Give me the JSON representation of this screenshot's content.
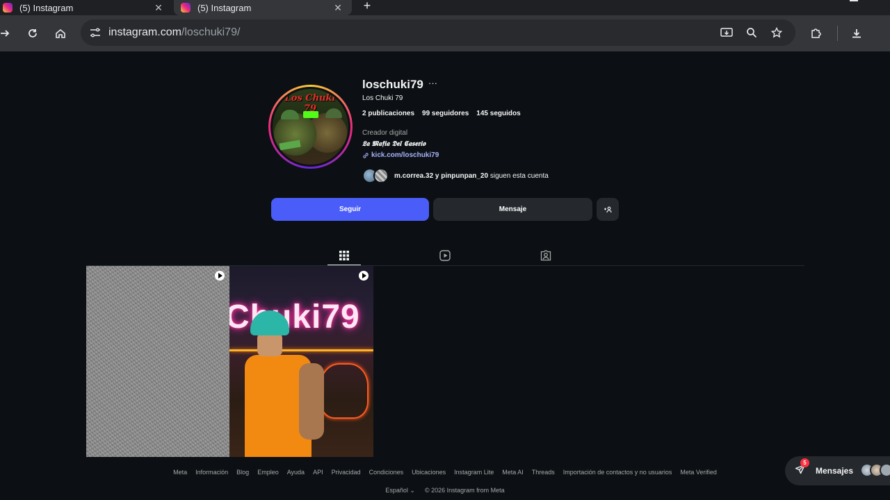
{
  "browser": {
    "tabs": [
      {
        "title": "(5) Instagram"
      },
      {
        "title": "(5) Instagram"
      }
    ],
    "url_host": "instagram.com",
    "url_path": "/loschuki79/"
  },
  "profile": {
    "username": "loschuki79",
    "full_name": "Los Chuki 79",
    "posts": "2 publicaciones",
    "followers": "99 seguidores",
    "following": "145 seguidos",
    "category": "Creador digital",
    "bio": "𝕷𝖆 𝕸𝖆𝖋𝖎𝖆 𝕯𝖊𝖑 𝕮𝖆𝖘𝖊𝖗𝖎𝖔",
    "link": "kick.com/loschuki79",
    "followed_by_names": "m.correa.32 y pinpunpan_20",
    "followed_by_suffix": " siguen esta cuenta",
    "avatar_text": "Los Chuki 79",
    "avatar_logo": "Los Chuki 79"
  },
  "actions": {
    "follow": "Seguir",
    "message": "Mensaje",
    "suggest": "+2"
  },
  "grid": {
    "post2_neon": "Chuki79"
  },
  "footer": {
    "links": [
      "Meta",
      "Información",
      "Blog",
      "Empleo",
      "Ayuda",
      "API",
      "Privacidad",
      "Condiciones",
      "Ubicaciones",
      "Instagram Lite",
      "Meta AI",
      "Threads",
      "Importación de contactos y no usuarios",
      "Meta Verified"
    ],
    "language": "Español",
    "copyright": "© 2026 Instagram from Meta"
  },
  "messages": {
    "label": "Mensajes",
    "badge": "5"
  },
  "colors": {
    "follow_button": "#4a5df9",
    "link": "#a5b4fc",
    "badge": "#ff3040"
  }
}
